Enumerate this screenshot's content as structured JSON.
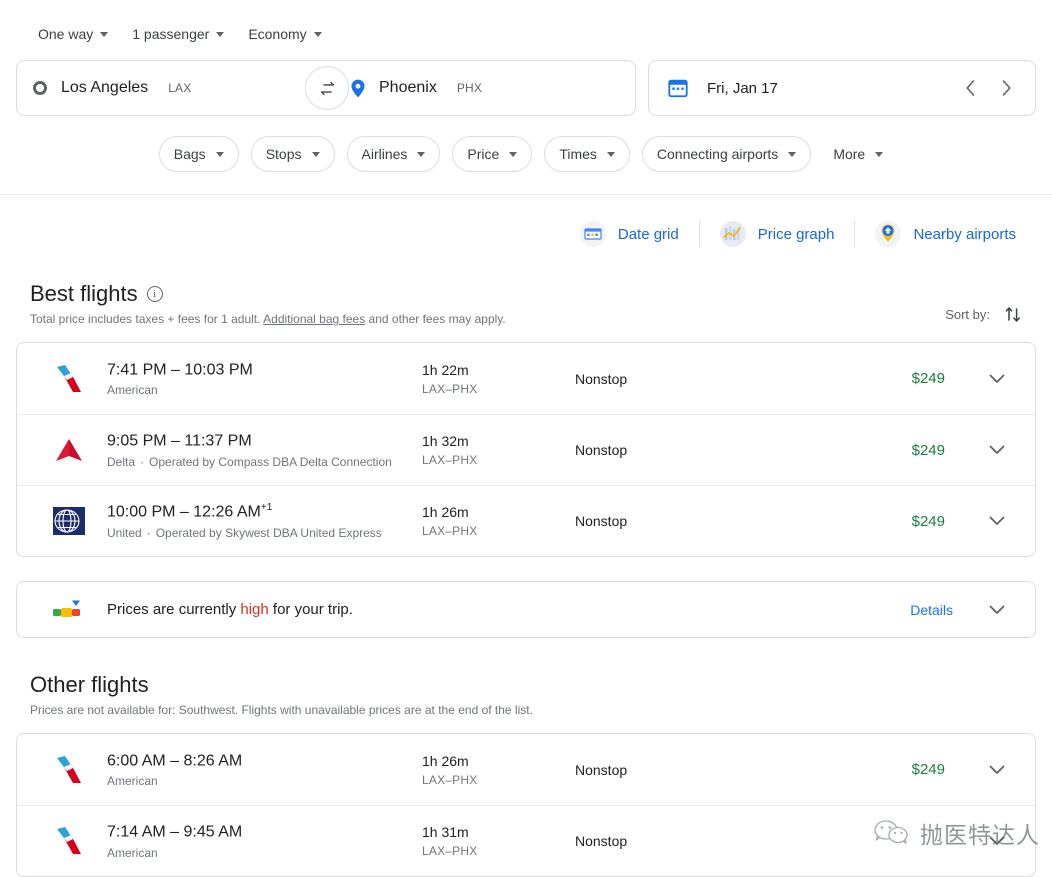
{
  "search": {
    "trip_type": "One way",
    "passengers": "1 passenger",
    "cabin_class": "Economy",
    "origin": {
      "city": "Los Angeles",
      "code": "LAX",
      "icon": "circle-outline-icon"
    },
    "destination": {
      "city": "Phoenix",
      "code": "PHX",
      "icon": "map-pin-icon"
    },
    "swap_icon": "swap-horizontal-icon",
    "date": "Fri, Jan 17",
    "date_icon": "calendar-icon",
    "prev_icon": "chevron-left-icon",
    "next_icon": "chevron-right-icon"
  },
  "filters": [
    {
      "label": "Bags",
      "pill": true
    },
    {
      "label": "Stops",
      "pill": true
    },
    {
      "label": "Airlines",
      "pill": true
    },
    {
      "label": "Price",
      "pill": true
    },
    {
      "label": "Times",
      "pill": true
    },
    {
      "label": "Connecting airports",
      "pill": true
    },
    {
      "label": "More",
      "pill": false
    }
  ],
  "tools": [
    {
      "label": "Date grid",
      "icon": "date-grid-icon"
    },
    {
      "label": "Price graph",
      "icon": "price-graph-icon"
    },
    {
      "label": "Nearby airports",
      "icon": "nearby-airports-icon"
    }
  ],
  "best_flights": {
    "title": "Best flights",
    "info_icon": "info-icon",
    "subtitle_before": "Total price includes taxes + fees for 1 adult. ",
    "subtitle_link": "Additional bag fees",
    "subtitle_after": " and other fees may apply.",
    "sort_label": "Sort by:",
    "sort_icon": "sort-arrows-icon",
    "rows": [
      {
        "airline_logo": "american-airlines-logo",
        "times": "7:41 PM – 10:03 PM",
        "plus_days": "",
        "operator": "American",
        "operator_detail": "",
        "duration": "1h 22m",
        "route": "LAX–PHX",
        "stops": "Nonstop",
        "price": "$249",
        "expand_icon": "chevron-down-icon"
      },
      {
        "airline_logo": "delta-logo",
        "times": "9:05 PM – 11:37 PM",
        "plus_days": "",
        "operator": "Delta",
        "operator_detail": "Operated by Compass DBA Delta Connection",
        "duration": "1h 32m",
        "route": "LAX–PHX",
        "stops": "Nonstop",
        "price": "$249",
        "expand_icon": "chevron-down-icon"
      },
      {
        "airline_logo": "united-logo",
        "times": "10:00 PM – 12:26 AM",
        "plus_days": "+1",
        "operator": "United",
        "operator_detail": "Operated by Skywest DBA United Express",
        "duration": "1h 26m",
        "route": "LAX–PHX",
        "stops": "Nonstop",
        "price": "$249",
        "expand_icon": "chevron-down-icon"
      }
    ]
  },
  "price_banner": {
    "icon": "price-gauge-icon",
    "text_before": "Prices are currently ",
    "highlight": "high",
    "text_after": " for your trip.",
    "details_label": "Details",
    "expand_icon": "chevron-down-icon"
  },
  "other_flights": {
    "title": "Other flights",
    "subtitle": "Prices are not available for: Southwest. Flights with unavailable prices are at the end of the list.",
    "rows": [
      {
        "airline_logo": "american-airlines-logo",
        "times": "6:00 AM – 8:26 AM",
        "plus_days": "",
        "operator": "American",
        "operator_detail": "",
        "duration": "1h 26m",
        "route": "LAX–PHX",
        "stops": "Nonstop",
        "price": "$249",
        "expand_icon": "chevron-down-icon"
      },
      {
        "airline_logo": "american-airlines-logo",
        "times": "7:14 AM – 9:45 AM",
        "plus_days": "",
        "operator": "American",
        "operator_detail": "",
        "duration": "1h 31m",
        "route": "LAX–PHX",
        "stops": "Nonstop",
        "price": "",
        "expand_icon": "chevron-down-icon"
      }
    ]
  },
  "watermark": {
    "icon": "wechat-icon",
    "text": "抛医特达人"
  },
  "colors": {
    "price_green": "#188038",
    "link_blue": "#1a73e8",
    "alert_red": "#d93025",
    "border_gray": "#dadce0",
    "text_secondary": "#70757a"
  }
}
